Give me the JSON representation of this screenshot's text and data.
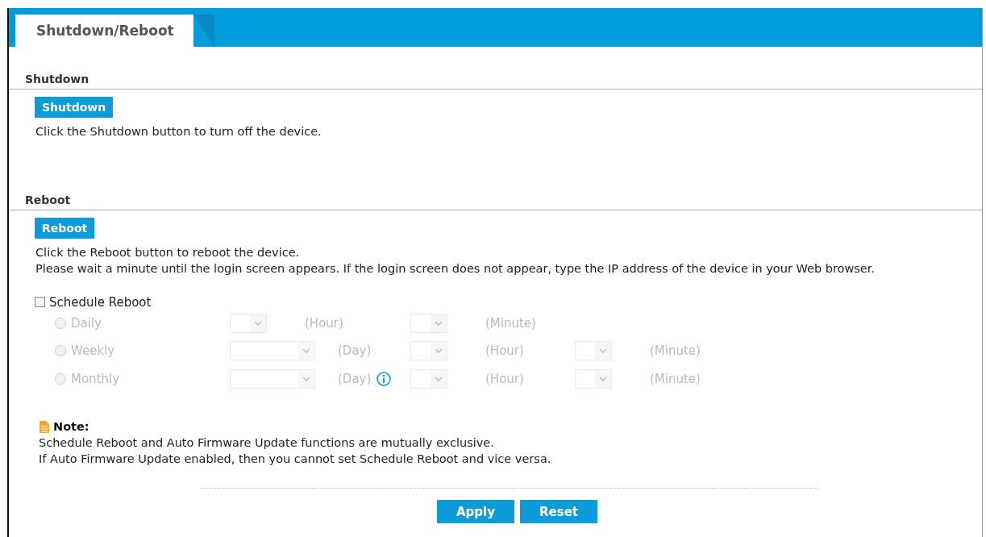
{
  "tabs": [
    {
      "label": "Shutdown/Reboot",
      "selected": true
    }
  ],
  "shutdown": {
    "title": "Shutdown",
    "button": "Shutdown",
    "description": [
      "Click the Shutdown button to turn off the device."
    ]
  },
  "reboot": {
    "title": "Reboot",
    "button": "Reboot",
    "description": [
      "Click the Reboot button to reboot the device.",
      "Please wait a minute until the login screen appears. If the login screen does not appear, type the IP address of the device in your Web browser."
    ]
  },
  "schedule": {
    "label": "Schedule Reboot",
    "checked": false,
    "options": [
      {
        "label": "Daily",
        "selected": false,
        "disabled": true,
        "groups": [
          {
            "kind": "narrow",
            "unit": "(Hour)"
          },
          {
            "kind": "narrow",
            "unit": "(Minute)"
          }
        ]
      },
      {
        "label": "Weekly",
        "selected": false,
        "disabled": true,
        "groups": [
          {
            "kind": "wide",
            "unit": "(Day)"
          },
          {
            "kind": "narrow",
            "unit": "(Hour)"
          },
          {
            "kind": "narrow",
            "unit": "(Minute)"
          }
        ]
      },
      {
        "label": "Monthly",
        "selected": false,
        "disabled": true,
        "groups": [
          {
            "kind": "wide",
            "unit": "(Day)",
            "info": true
          },
          {
            "kind": "narrow",
            "unit": "(Hour)"
          },
          {
            "kind": "narrow",
            "unit": "(Minute)"
          }
        ]
      }
    ]
  },
  "note": {
    "title": "Note:",
    "lines": [
      "Schedule Reboot and Auto Firmware Update functions are mutually exclusive.",
      "If Auto Firmware Update enabled, then you cannot set Schedule Reboot and vice versa."
    ]
  },
  "buttons": [
    "Apply",
    "Reset"
  ]
}
